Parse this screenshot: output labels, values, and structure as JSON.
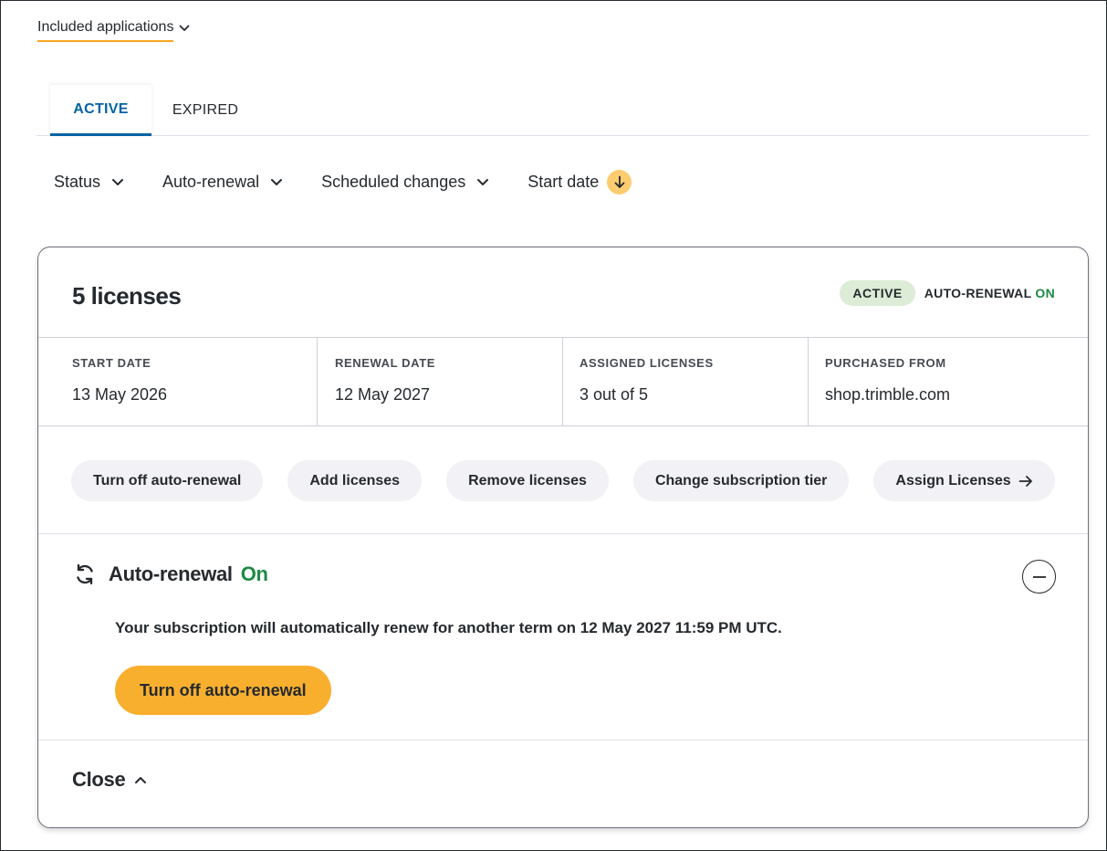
{
  "header": {
    "included_apps_label": "Included applications"
  },
  "tabs": [
    {
      "label": "ACTIVE",
      "selected": true
    },
    {
      "label": "EXPIRED",
      "selected": false
    }
  ],
  "filters": {
    "status": "Status",
    "auto_renewal": "Auto-renewal",
    "scheduled_changes": "Scheduled changes",
    "start_date": "Start date"
  },
  "subscription": {
    "title": "5 licenses",
    "status_badge": "ACTIVE",
    "auto_renewal_label": "AUTO-RENEWAL",
    "auto_renewal_value": "ON",
    "info": [
      {
        "label": "START DATE",
        "value": "13 May 2026"
      },
      {
        "label": "RENEWAL DATE",
        "value": "12 May 2027"
      },
      {
        "label": "ASSIGNED LICENSES",
        "value": "3 out of 5"
      },
      {
        "label": "PURCHASED FROM",
        "value": "shop.trimble.com"
      }
    ],
    "actions": {
      "turn_off": "Turn off auto-renewal",
      "add": "Add licenses",
      "remove": "Remove licenses",
      "change_tier": "Change subscription tier",
      "assign": "Assign Licenses"
    }
  },
  "auto_renewal_panel": {
    "heading": "Auto-renewal",
    "state": "On",
    "message": "Your subscription will automatically renew for another term on 12 May 2027 11:59 PM UTC.",
    "button": "Turn off auto-renewal"
  },
  "footer": {
    "close_label": "Close"
  },
  "colors": {
    "accent_blue": "#0063a3",
    "accent_yellow": "#f9af2e",
    "success_green": "#1e8a44",
    "badge_bg": "#dcecd6",
    "pill_bg": "#f1f1f6"
  }
}
